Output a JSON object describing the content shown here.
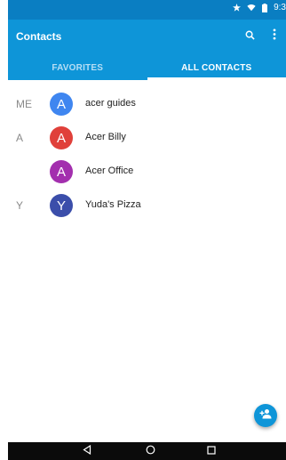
{
  "status_bar": {
    "time": "9:3",
    "icons": [
      "star-icon",
      "wifi-icon",
      "battery-icon"
    ],
    "color": "#0a7ec2"
  },
  "app_bar": {
    "title": "Contacts",
    "actions": [
      "search-icon",
      "more-vert-icon"
    ],
    "color": "#0e95d8"
  },
  "tabs": [
    {
      "label": "FAVORITES",
      "active": false
    },
    {
      "label": "ALL CONTACTS",
      "active": true
    }
  ],
  "contacts": [
    {
      "section": "ME",
      "initial": "A",
      "name": "acer guides",
      "color": "#3f86f0"
    },
    {
      "section": "A",
      "initial": "A",
      "name": "Acer Billy",
      "color": "#e0403a"
    },
    {
      "section": "",
      "initial": "A",
      "name": "Acer Office",
      "color": "#a32fae"
    },
    {
      "section": "Y",
      "initial": "Y",
      "name": "Yuda's Pizza",
      "color": "#3b4eaa"
    }
  ],
  "fab": {
    "icon": "add-contact-icon"
  },
  "nav_bar": {
    "buttons": [
      "back-icon",
      "home-icon",
      "recents-icon"
    ]
  }
}
